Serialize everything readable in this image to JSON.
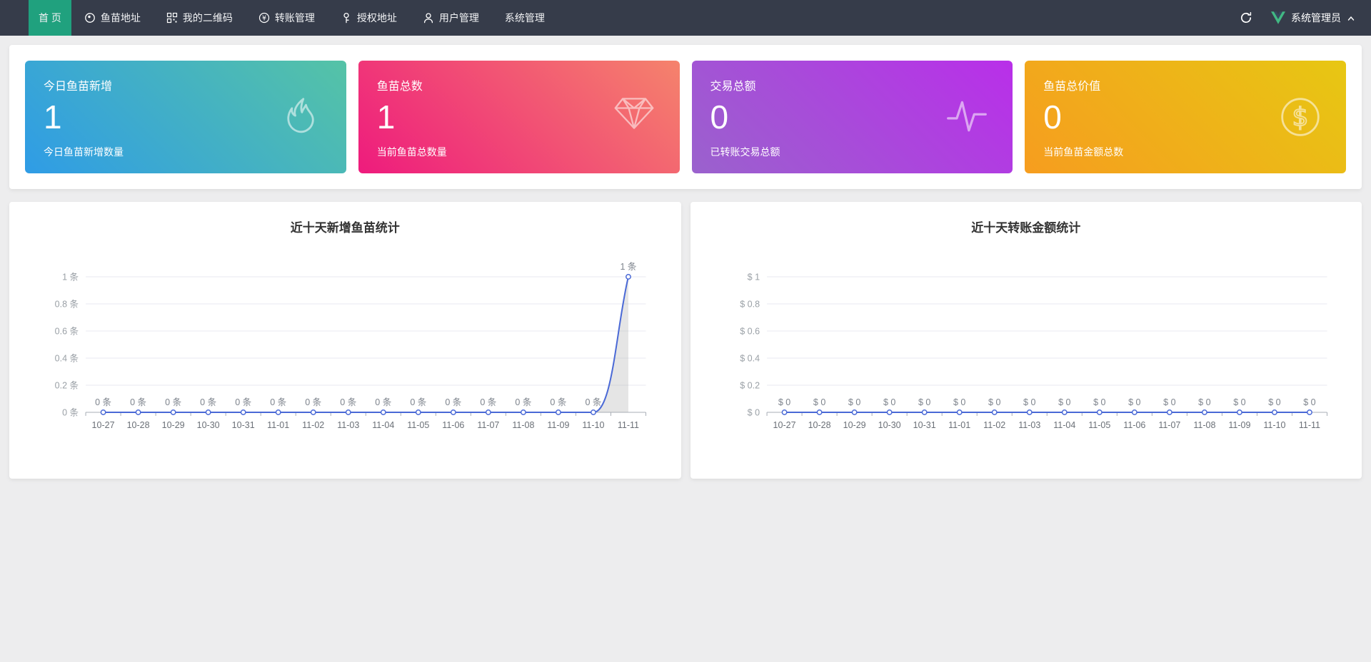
{
  "navbar": {
    "colors": {
      "background": "#363c4a",
      "active_background": "#20a17e"
    },
    "items": [
      {
        "label": "首 页",
        "icon": null,
        "active": true
      },
      {
        "label": "鱼苗地址",
        "icon": "target-circle-icon",
        "active": false
      },
      {
        "label": "我的二维码",
        "icon": "qrcode-icon",
        "active": false
      },
      {
        "label": "转账管理",
        "icon": "yen-circle-icon",
        "active": false
      },
      {
        "label": "授权地址",
        "icon": "key-icon",
        "active": false
      },
      {
        "label": "用户管理",
        "icon": "user-icon",
        "active": false
      },
      {
        "label": "系统管理",
        "icon": null,
        "active": false
      }
    ],
    "admin_label": "系统管理员"
  },
  "stat_cards": [
    {
      "title": "今日鱼苗新增",
      "value": "1",
      "subtitle": "今日鱼苗新增数量",
      "icon": "flame-icon",
      "gradient_from": "#2f9ce6",
      "gradient_to": "#55c3a6"
    },
    {
      "title": "鱼苗总数",
      "value": "1",
      "subtitle": "当前鱼苗总数量",
      "icon": "diamond-icon",
      "gradient_from": "#ee1b7d",
      "gradient_to": "#f5836c"
    },
    {
      "title": "交易总额",
      "value": "0",
      "subtitle": "已转账交易总额",
      "icon": "pulse-icon",
      "gradient_from": "#9a62cd",
      "gradient_to": "#b92fe9"
    },
    {
      "title": "鱼苗总价值",
      "value": "0",
      "subtitle": "当前鱼苗金额总数",
      "icon": "dollar-circle-icon",
      "gradient_from": "#f69d1f",
      "gradient_to": "#e7c713"
    }
  ],
  "chart_data": [
    {
      "type": "line",
      "title": "近十天新增鱼苗统计",
      "x": [
        "10-27",
        "10-28",
        "10-29",
        "10-30",
        "10-31",
        "11-01",
        "11-02",
        "11-03",
        "11-04",
        "11-05",
        "11-06",
        "11-07",
        "11-08",
        "11-09",
        "11-10",
        "11-11"
      ],
      "values": [
        0,
        0,
        0,
        0,
        0,
        0,
        0,
        0,
        0,
        0,
        0,
        0,
        0,
        0,
        0,
        1
      ],
      "point_labels": [
        "0 条",
        "0 条",
        "0 条",
        "0 条",
        "0 条",
        "0 条",
        "0 条",
        "0 条",
        "0 条",
        "0 条",
        "0 条",
        "0 条",
        "0 条",
        "0 条",
        "0 条",
        "1 条"
      ],
      "ytick_values": [
        0,
        0.2,
        0.4,
        0.6,
        0.8,
        1
      ],
      "ytick_labels": [
        "0 条",
        "0.2 条",
        "0.4 条",
        "0.6 条",
        "0.8 条",
        "1 条"
      ],
      "ylim": [
        0,
        1
      ],
      "smooth": true,
      "grid": true,
      "legend": null,
      "line_color": "#4a69d6",
      "area_color": "rgba(170,170,170,0.30)"
    },
    {
      "type": "line",
      "title": "近十天转账金额统计",
      "x": [
        "10-27",
        "10-28",
        "10-29",
        "10-30",
        "10-31",
        "11-01",
        "11-02",
        "11-03",
        "11-04",
        "11-05",
        "11-06",
        "11-07",
        "11-08",
        "11-09",
        "11-10",
        "11-11"
      ],
      "values": [
        0,
        0,
        0,
        0,
        0,
        0,
        0,
        0,
        0,
        0,
        0,
        0,
        0,
        0,
        0,
        0
      ],
      "point_labels": [
        "$ 0",
        "$ 0",
        "$ 0",
        "$ 0",
        "$ 0",
        "$ 0",
        "$ 0",
        "$ 0",
        "$ 0",
        "$ 0",
        "$ 0",
        "$ 0",
        "$ 0",
        "$ 0",
        "$ 0",
        "$ 0"
      ],
      "ytick_values": [
        0,
        0.2,
        0.4,
        0.6,
        0.8,
        1
      ],
      "ytick_labels": [
        "$ 0",
        "$ 0.2",
        "$ 0.4",
        "$ 0.6",
        "$ 0.8",
        "$ 1"
      ],
      "ylim": [
        0,
        1
      ],
      "smooth": true,
      "grid": true,
      "legend": null,
      "line_color": "#4a69d6",
      "area_color": "rgba(170,170,170,0.30)"
    }
  ]
}
